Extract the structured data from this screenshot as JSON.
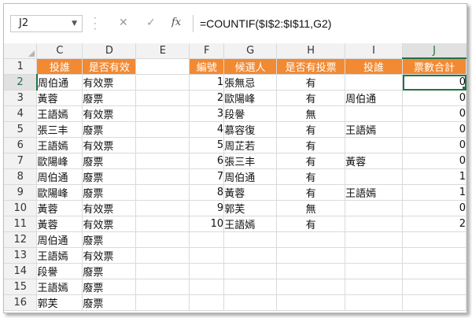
{
  "formula_bar": {
    "name_box": "J2",
    "cancel_icon": "✕",
    "enter_icon": "✓",
    "fx_label": "fx",
    "formula": "=COUNTIF($I$2:$I$11,G2)"
  },
  "columns": [
    "C",
    "D",
    "E",
    "F",
    "G",
    "H",
    "I",
    "J"
  ],
  "selected_cell": "J2",
  "accent_color": "#f18a33",
  "rows": [
    {
      "n": "1",
      "C": "投誰",
      "D": "是否有效",
      "E": "",
      "F": "編號",
      "G": "候選人",
      "H": "是否有投票",
      "I": "投誰",
      "J": "票數合計"
    },
    {
      "n": "2",
      "C": "周伯通",
      "D": "有效票",
      "E": "",
      "F": "1",
      "G": "張無忌",
      "H": "有",
      "I": "",
      "J": "0"
    },
    {
      "n": "3",
      "C": "黃蓉",
      "D": "廢票",
      "E": "",
      "F": "2",
      "G": "歐陽峰",
      "H": "有",
      "I": "周伯通",
      "J": "0"
    },
    {
      "n": "4",
      "C": "王語嫣",
      "D": "有效票",
      "E": "",
      "F": "3",
      "G": "段譽",
      "H": "無",
      "I": "",
      "J": "0"
    },
    {
      "n": "5",
      "C": "張三丰",
      "D": "廢票",
      "E": "",
      "F": "4",
      "G": "慕容復",
      "H": "有",
      "I": "王語嫣",
      "J": "0"
    },
    {
      "n": "6",
      "C": "王語嫣",
      "D": "有效票",
      "E": "",
      "F": "5",
      "G": "周芷若",
      "H": "有",
      "I": "",
      "J": "0"
    },
    {
      "n": "7",
      "C": "歐陽峰",
      "D": "廢票",
      "E": "",
      "F": "6",
      "G": "張三丰",
      "H": "有",
      "I": "黃蓉",
      "J": "0"
    },
    {
      "n": "8",
      "C": "周伯通",
      "D": "廢票",
      "E": "",
      "F": "7",
      "G": "周伯通",
      "H": "有",
      "I": "",
      "J": "1"
    },
    {
      "n": "9",
      "C": "歐陽峰",
      "D": "廢票",
      "E": "",
      "F": "8",
      "G": "黃蓉",
      "H": "有",
      "I": "王語嫣",
      "J": "1"
    },
    {
      "n": "10",
      "C": "黃蓉",
      "D": "有效票",
      "E": "",
      "F": "9",
      "G": "郭芙",
      "H": "無",
      "I": "",
      "J": "0"
    },
    {
      "n": "11",
      "C": "黃蓉",
      "D": "有效票",
      "E": "",
      "F": "10",
      "G": "王語嫣",
      "H": "有",
      "I": "",
      "J": "2"
    },
    {
      "n": "12",
      "C": "周伯通",
      "D": "廢票",
      "E": "",
      "F": "",
      "G": "",
      "H": "",
      "I": "",
      "J": ""
    },
    {
      "n": "13",
      "C": "王語嫣",
      "D": "有效票",
      "E": "",
      "F": "",
      "G": "",
      "H": "",
      "I": "",
      "J": ""
    },
    {
      "n": "14",
      "C": "段譽",
      "D": "廢票",
      "E": "",
      "F": "",
      "G": "",
      "H": "",
      "I": "",
      "J": ""
    },
    {
      "n": "15",
      "C": "王語嫣",
      "D": "廢票",
      "E": "",
      "F": "",
      "G": "",
      "H": "",
      "I": "",
      "J": ""
    },
    {
      "n": "16",
      "C": "郭芙",
      "D": "廢票",
      "E": "",
      "F": "",
      "G": "",
      "H": "",
      "I": "",
      "J": ""
    }
  ]
}
